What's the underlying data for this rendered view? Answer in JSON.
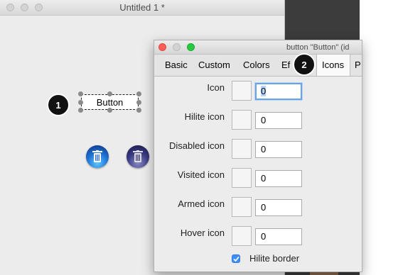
{
  "main_window": {
    "title": "Untitled 1 *"
  },
  "canvas": {
    "button_label": "Button"
  },
  "badges": {
    "b1": "1",
    "b2": "2"
  },
  "inspector": {
    "title": "button \"Button\" (id",
    "tabs": [
      "Basic",
      "Custom",
      "Colors",
      "Ef",
      "Icons",
      "P"
    ],
    "rows": [
      {
        "label": "Icon",
        "value": "0"
      },
      {
        "label": "Hilite icon",
        "value": "0"
      },
      {
        "label": "Disabled icon",
        "value": "0"
      },
      {
        "label": "Visited icon",
        "value": "0"
      },
      {
        "label": "Armed icon",
        "value": "0"
      },
      {
        "label": "Hover icon",
        "value": "0"
      }
    ],
    "hilite_border_label": "Hilite border",
    "hilite_border_checked": true
  },
  "background": {
    "scroll_glyph": "“>"
  },
  "colors": {
    "accent": "#3d8ff6",
    "focus_ring": "#6aa4e6"
  }
}
